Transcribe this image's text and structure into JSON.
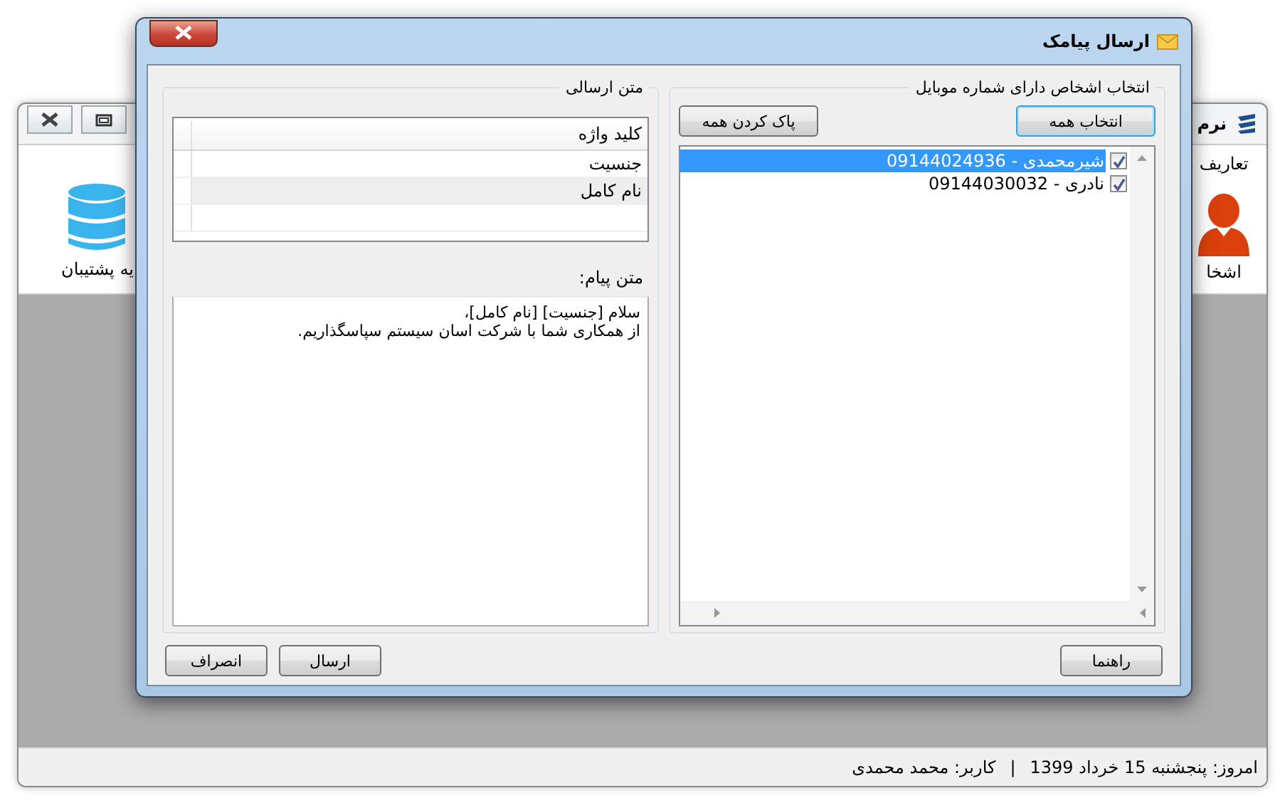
{
  "background_window": {
    "title": "نرم",
    "tab": "تعاریف",
    "ribbon_items": [
      {
        "label": "اشخا",
        "kind": "person"
      },
      {
        "label": "یه پشتیبان",
        "kind": "database"
      }
    ],
    "status_bar": [
      "امروز: پنجشنبه 15 خرداد 1399",
      "|",
      "کاربر: محمد محمدی"
    ]
  },
  "dialog": {
    "title": "ارسال پیامک",
    "contacts_group": {
      "title": "انتخاب اشخاص دارای شماره موبایل",
      "buttons": [
        {
          "label": "انتخاب همه",
          "default": true
        },
        {
          "label": "پاک کردن همه",
          "default": false
        }
      ],
      "contacts": [
        {
          "label": "شیرمحمدی - 09144024936",
          "checked": true,
          "selected": true
        },
        {
          "label": "نادری - 09144030032",
          "checked": true,
          "selected": false
        }
      ]
    },
    "message_group": {
      "title": "متن ارسالی",
      "table": {
        "columns": [
          "کلید واژه"
        ],
        "rows": [
          {
            "cells": [
              "جنسیت"
            ],
            "selected": false
          },
          {
            "cells": [
              "نام کامل"
            ],
            "selected": true
          }
        ]
      },
      "message_label": "متن پیام:",
      "message": "سلام [جنسیت] [نام کامل]،\nاز همکاری شما با شرکت اسان سیستم سپاسگذاریم."
    },
    "buttons": [
      {
        "label": "راهنما",
        "kind": "help"
      },
      {
        "label": "ارسال",
        "kind": "action"
      },
      {
        "label": "انصراف",
        "kind": "action"
      }
    ]
  }
}
